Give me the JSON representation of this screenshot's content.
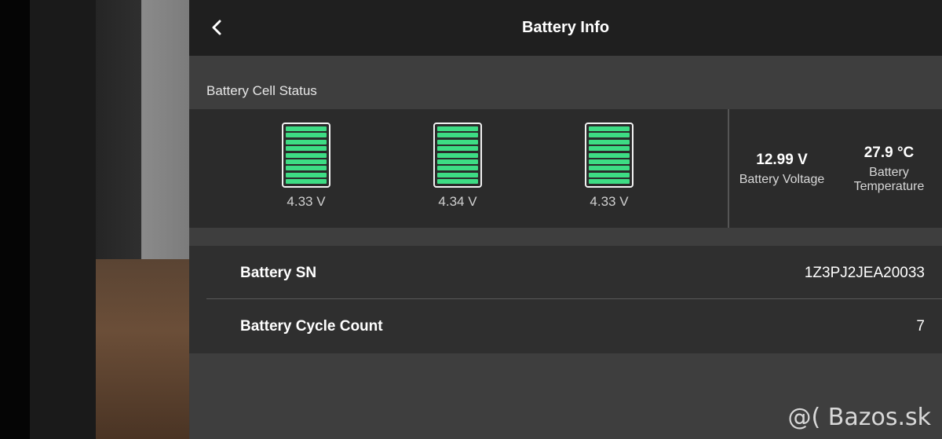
{
  "header": {
    "title": "Battery Info"
  },
  "cell_status": {
    "section_label": "Battery Cell Status",
    "cells": [
      {
        "voltage": "4.33 V",
        "level": 1.0
      },
      {
        "voltage": "4.34 V",
        "level": 1.0
      },
      {
        "voltage": "4.33 V",
        "level": 1.0
      }
    ],
    "battery_voltage": {
      "value": "12.99 V",
      "label": "Battery Voltage"
    },
    "battery_temperature": {
      "value": "27.9 °C",
      "label": "Battery Temperature"
    }
  },
  "info": {
    "sn": {
      "label": "Battery SN",
      "value": "1Z3PJ2JEA20033"
    },
    "cycle_count": {
      "label": "Battery Cycle Count",
      "value": "7"
    }
  },
  "watermark": "@( Bazos.sk",
  "colors": {
    "cell_fill": "#3ddc84"
  }
}
